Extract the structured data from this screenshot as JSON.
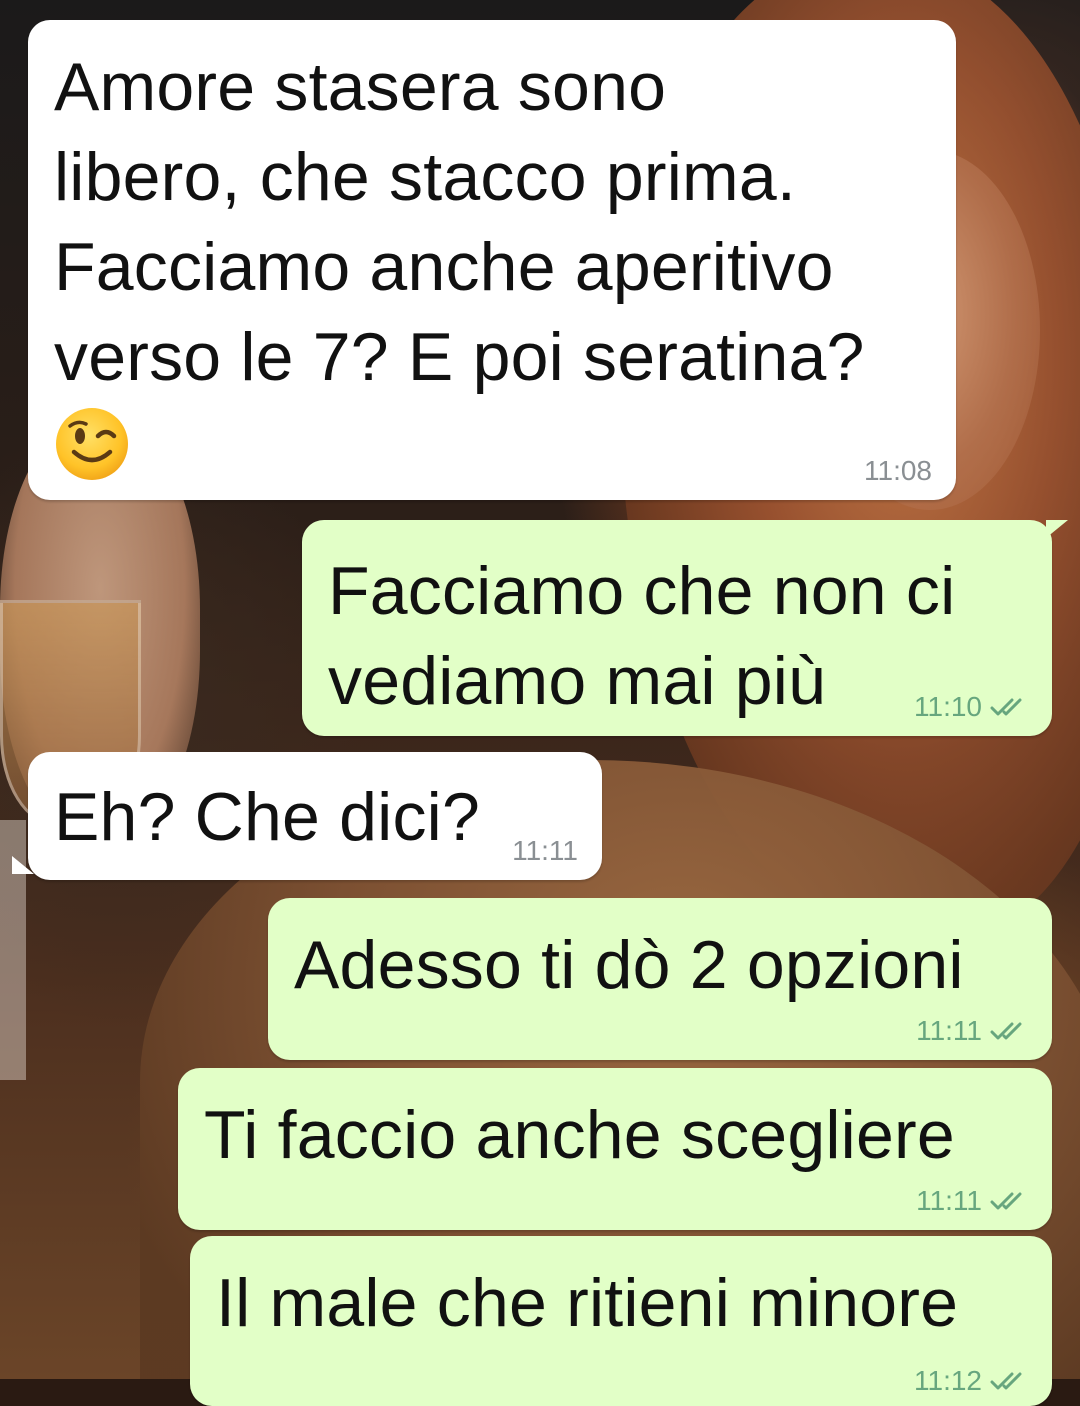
{
  "messages": [
    {
      "id": "m1",
      "direction": "incoming",
      "text": "Amore stasera sono\nlibero, che stacco prima.\nFacciamo anche aperitivo\nverso le 7? E poi seratina?",
      "emoji": "winking-face",
      "time": "11:08"
    },
    {
      "id": "m2",
      "direction": "outgoing",
      "text": "Facciamo che non ci\nvediamo mai più",
      "time": "11:10",
      "status": "read"
    },
    {
      "id": "m3",
      "direction": "incoming",
      "text": "Eh? Che dici?",
      "time": "11:11"
    },
    {
      "id": "m4",
      "direction": "outgoing",
      "text": "Adesso ti dò 2 opzioni",
      "time": "11:11",
      "status": "read"
    },
    {
      "id": "m5",
      "direction": "outgoing",
      "text": "Ti faccio anche scegliere",
      "time": "11:11",
      "status": "read"
    },
    {
      "id": "m6",
      "direction": "outgoing",
      "text": "Il male che ritieni minore",
      "time": "11:12",
      "status": "read"
    }
  ],
  "colors": {
    "incoming_bubble": "#ffffff",
    "outgoing_bubble": "#e2ffc7",
    "read_tick": "#67a67e",
    "incoming_time": "#8a8f93"
  }
}
